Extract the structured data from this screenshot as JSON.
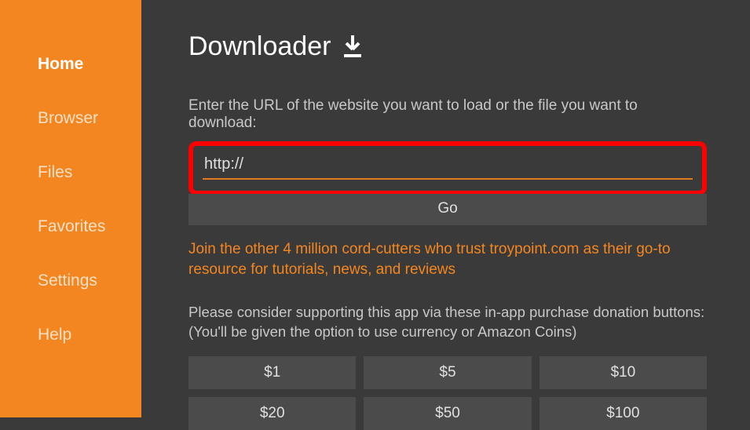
{
  "sidebar": {
    "items": [
      {
        "label": "Home",
        "active": true
      },
      {
        "label": "Browser",
        "active": false
      },
      {
        "label": "Files",
        "active": false
      },
      {
        "label": "Favorites",
        "active": false
      },
      {
        "label": "Settings",
        "active": false
      },
      {
        "label": "Help",
        "active": false
      }
    ]
  },
  "header": {
    "title": "Downloader"
  },
  "main": {
    "instruction": "Enter the URL of the website you want to load or the file you want to download:",
    "url_value": "http://",
    "go_label": "Go",
    "promo": "Join the other 4 million cord-cutters who trust troypoint.com as their go-to resource for tutorials, news, and reviews",
    "donate_prompt_line1": "Please consider supporting this app via these in-app purchase donation buttons:",
    "donate_prompt_line2": "(You'll be given the option to use currency or Amazon Coins)",
    "donate_buttons": [
      "$1",
      "$5",
      "$10",
      "$20",
      "$50",
      "$100"
    ]
  },
  "colors": {
    "accent": "#f38620",
    "highlight_border": "#ff0000",
    "bg": "#3a3a3a",
    "button_bg": "#4b4b4b"
  }
}
